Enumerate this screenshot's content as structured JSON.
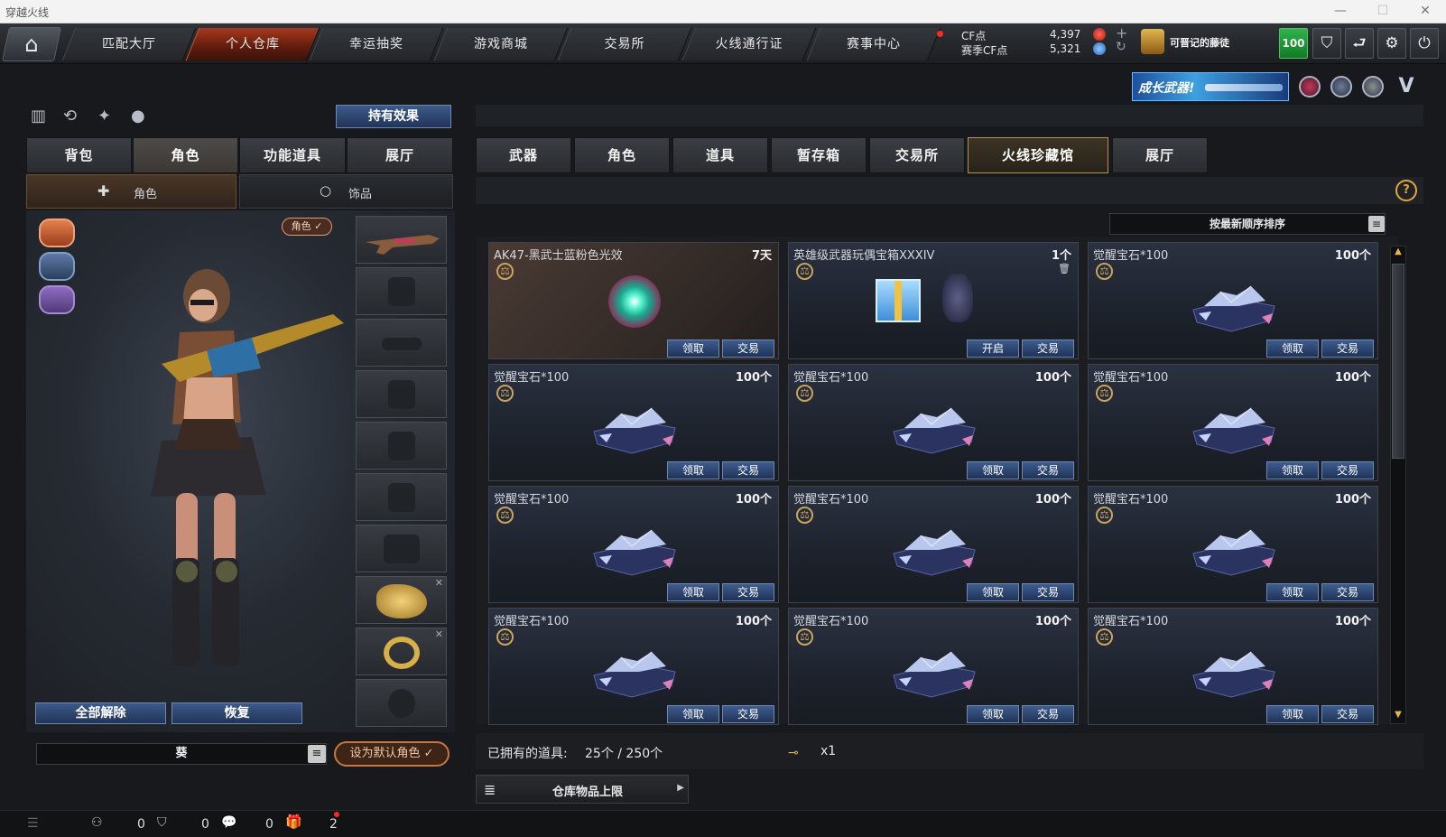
{
  "window": {
    "title": "穿越火线",
    "min": "—",
    "max": "☐",
    "close": "✕"
  },
  "nav": {
    "home_icon": "home-icon",
    "tabs": [
      "匹配大厅",
      "个人仓库",
      "幸运抽奖",
      "游戏商城",
      "交易所",
      "火线通行证",
      "赛事中心"
    ],
    "active_tab": 1,
    "cf_label": "CF点",
    "cf_value": "4,397",
    "season_label": "赛季CF点",
    "season_value": "5,321",
    "plus": "+",
    "refresh": "↻",
    "level_title": "可晋记的藤徒",
    "level_badge": "100"
  },
  "banner": {
    "text": "成长武器!"
  },
  "left": {
    "effect_button": "持有效果",
    "tabs": [
      "背包",
      "角色",
      "功能道具",
      "展厅"
    ],
    "active_tab": 1,
    "subtabs": [
      "角色",
      "饰品"
    ],
    "role_tag": "角色 ✓",
    "release_all": "全部解除",
    "restore": "恢复",
    "char_name": "葵",
    "set_default": "设为默认角色 ✓"
  },
  "right": {
    "tabs": [
      "武器",
      "角色",
      "道具",
      "暂存箱",
      "交易所",
      "火线珍藏馆",
      "展厅"
    ],
    "active_tab": 5,
    "help": "?",
    "sort_label": "按最新顺序排序",
    "items": [
      {
        "name": "AK47-黑武士蓝粉色光效",
        "qty": "7天",
        "b1": "领取",
        "b2": "交易",
        "kind": "orb"
      },
      {
        "name": "英雄级武器玩偶宝箱XXXIV",
        "qty": "1个",
        "b1": "开启",
        "b2": "交易",
        "kind": "box"
      },
      {
        "name": "觉醒宝石*100",
        "qty": "100个",
        "b1": "领取",
        "b2": "交易",
        "kind": "gem"
      },
      {
        "name": "觉醒宝石*100",
        "qty": "100个",
        "b1": "领取",
        "b2": "交易",
        "kind": "gem"
      },
      {
        "name": "觉醒宝石*100",
        "qty": "100个",
        "b1": "领取",
        "b2": "交易",
        "kind": "gem"
      },
      {
        "name": "觉醒宝石*100",
        "qty": "100个",
        "b1": "领取",
        "b2": "交易",
        "kind": "gem"
      },
      {
        "name": "觉醒宝石*100",
        "qty": "100个",
        "b1": "领取",
        "b2": "交易",
        "kind": "gem"
      },
      {
        "name": "觉醒宝石*100",
        "qty": "100个",
        "b1": "领取",
        "b2": "交易",
        "kind": "gem"
      },
      {
        "name": "觉醒宝石*100",
        "qty": "100个",
        "b1": "领取",
        "b2": "交易",
        "kind": "gem"
      },
      {
        "name": "觉醒宝石*100",
        "qty": "100个",
        "b1": "领取",
        "b2": "交易",
        "kind": "gem"
      },
      {
        "name": "觉醒宝石*100",
        "qty": "100个",
        "b1": "领取",
        "b2": "交易",
        "kind": "gem"
      },
      {
        "name": "觉醒宝石*100",
        "qty": "100个",
        "b1": "领取",
        "b2": "交易",
        "kind": "gem"
      }
    ],
    "owned_label": "已拥有的道具:",
    "owned_value": "25个 / 250个",
    "key_count": "x1",
    "storage_limit": "仓库物品上限"
  },
  "statusbar": {
    "v1": "0",
    "v2": "0",
    "v3": "0",
    "v4": "2"
  },
  "colors": {
    "accent_red": "#a8381c",
    "button_blue": "#2b4775",
    "gold": "#b89450"
  }
}
